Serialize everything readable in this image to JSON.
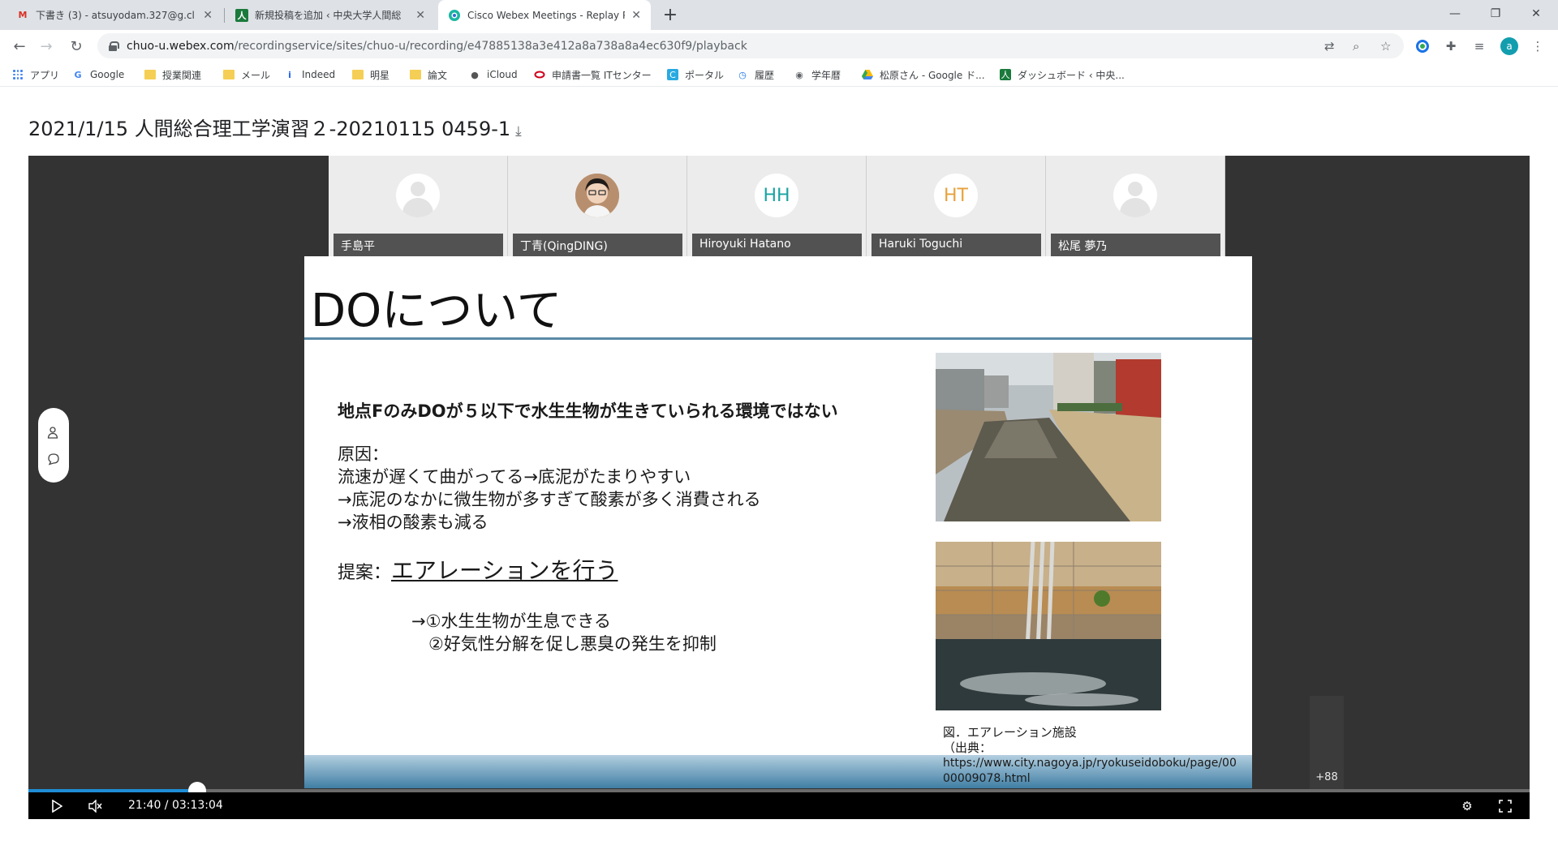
{
  "browser": {
    "tabs": [
      {
        "title": "下書き (3) - atsuyodam.327@g.cl",
        "favicon": "gmail-icon",
        "active": false
      },
      {
        "title": "新規投稿を追加 ‹ 中央大学人間総",
        "favicon": "person-kanji-icon",
        "active": false
      },
      {
        "title": "Cisco Webex Meetings - Replay P",
        "favicon": "webex-icon",
        "active": true
      }
    ],
    "new_tab_label": "+",
    "url_host": "chuo-u.webex.com",
    "url_path": "/recordingservice/sites/chuo-u/recording/e47885138a3e412a8a738a8a4ec630f9/playback",
    "profile_initial": "a",
    "bookmarks": [
      {
        "label": "アプリ",
        "icon": "apps-grid-icon"
      },
      {
        "label": "Google",
        "icon": "google-icon"
      },
      {
        "label": "授業関連",
        "icon": "folder-icon"
      },
      {
        "label": "メール",
        "icon": "folder-icon"
      },
      {
        "label": "Indeed",
        "icon": "indeed-icon"
      },
      {
        "label": "明星",
        "icon": "folder-icon"
      },
      {
        "label": "論文",
        "icon": "folder-icon"
      },
      {
        "label": "iCloud",
        "icon": "apple-icon"
      },
      {
        "label": "申請書一覧 ITセンター",
        "icon": "ring-icon"
      },
      {
        "label": "ポータル",
        "icon": "portal-icon"
      },
      {
        "label": "履歴",
        "icon": "history-icon"
      },
      {
        "label": "学年暦",
        "icon": "globe-icon"
      },
      {
        "label": "松原さん - Google ド...",
        "icon": "drive-icon"
      },
      {
        "label": "ダッシュボード ‹ 中央...",
        "icon": "person-kanji-icon"
      }
    ]
  },
  "recording": {
    "title": "2021/1/15 人間総合理工学演習２-20210115 0459-1",
    "download_icon": "download-icon"
  },
  "participants": [
    {
      "name": "手島平",
      "avatar": "default-silhouette",
      "initials": ""
    },
    {
      "name": "丁青(QingDING)",
      "avatar": "photo",
      "initials": ""
    },
    {
      "name": "Hiroyuki Hatano",
      "avatar": "initials",
      "initials": "HH",
      "color": "#1aa3a3"
    },
    {
      "name": "Haruki Toguchi",
      "avatar": "initials",
      "initials": "HT",
      "color": "#e6a23c"
    },
    {
      "name": "松尾 夢乃",
      "avatar": "default-silhouette",
      "initials": ""
    }
  ],
  "slide": {
    "title": "DOについて",
    "headline": "地点FのみDOが５以下で水生生物が生きていられる環境ではない",
    "cause_label": "原因：",
    "cause_lines": [
      "流速が遅くて曲がってる→底泥がたまりやすい",
      "→底泥のなかに微生物が多すぎて酸素が多く消費される",
      "→液相の酸素も減る"
    ],
    "proposal_label": "提案：",
    "proposal_text": "エアレーションを行う",
    "effect_lines": [
      "→①水生生物が生息できる",
      "　②好気性分解を促し悪臭の発生を抑制"
    ],
    "caption_lines": [
      "図．エアレーション施設",
      "（出典：",
      "https://www.city.nagoya.jp/ryokuseidoboku/page/00",
      "00009078.html"
    ]
  },
  "player": {
    "overflow_count": "+88",
    "timecode": "21:40 / 03:13:04",
    "progress_fraction": 0.1124,
    "accent_color": "#1e8dd6"
  }
}
